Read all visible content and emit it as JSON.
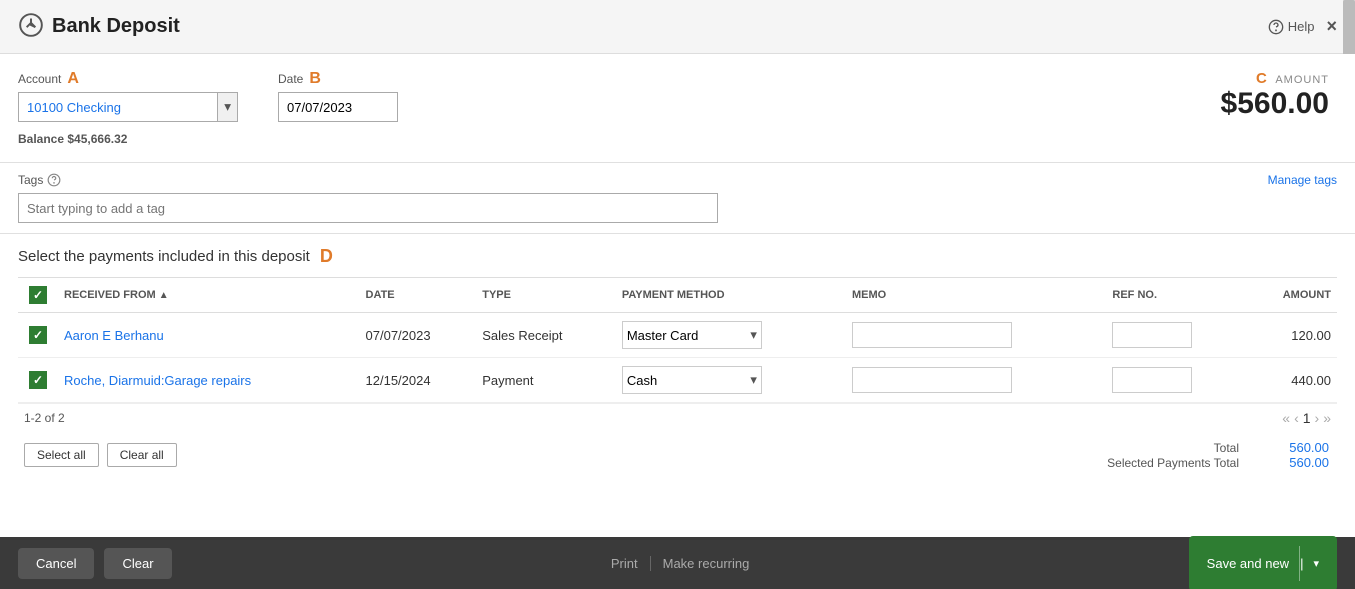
{
  "header": {
    "title": "Bank Deposit",
    "help_label": "Help",
    "close_label": "×"
  },
  "form": {
    "account_label": "Account",
    "account_letter": "A",
    "account_value": "10100 Checking",
    "balance_label": "Balance",
    "balance_value": "$45,666.32",
    "date_label": "Date",
    "date_letter": "B",
    "date_value": "07/07/2023",
    "amount_label": "AMOUNT",
    "amount_letter": "C",
    "amount_value": "$560.00"
  },
  "tags": {
    "label": "Tags",
    "placeholder": "Start typing to add a tag",
    "manage_link": "Manage tags"
  },
  "payments": {
    "section_title": "Select the payments included in this deposit",
    "section_letter": "D",
    "columns": {
      "received_from": "RECEIVED FROM",
      "date": "DATE",
      "type": "TYPE",
      "payment_method": "PAYMENT METHOD",
      "memo": "MEMO",
      "ref_no": "REF NO.",
      "amount": "AMOUNT"
    },
    "rows": [
      {
        "checked": true,
        "received_from": "Aaron E Berhanu",
        "date": "07/07/2023",
        "type": "Sales Receipt",
        "payment_method": "Master Card",
        "memo": "",
        "ref_no": "",
        "amount": "120.00"
      },
      {
        "checked": true,
        "received_from": "Roche, Diarmuid:Garage repairs",
        "date": "12/15/2024",
        "type": "Payment",
        "payment_method": "Cash",
        "memo": "",
        "ref_no": "",
        "amount": "440.00"
      }
    ],
    "pagination_text": "1-2 of 2",
    "page_number": "1",
    "select_all_label": "Select all",
    "clear_all_label": "Clear all",
    "total_label": "Total",
    "total_value": "560.00",
    "selected_total_label": "Selected Payments Total",
    "selected_total_value": "560.00"
  },
  "bottom_bar": {
    "cancel_label": "Cancel",
    "clear_label": "Clear",
    "print_label": "Print",
    "make_recurring_label": "Make recurring",
    "save_new_label": "Save and new"
  }
}
